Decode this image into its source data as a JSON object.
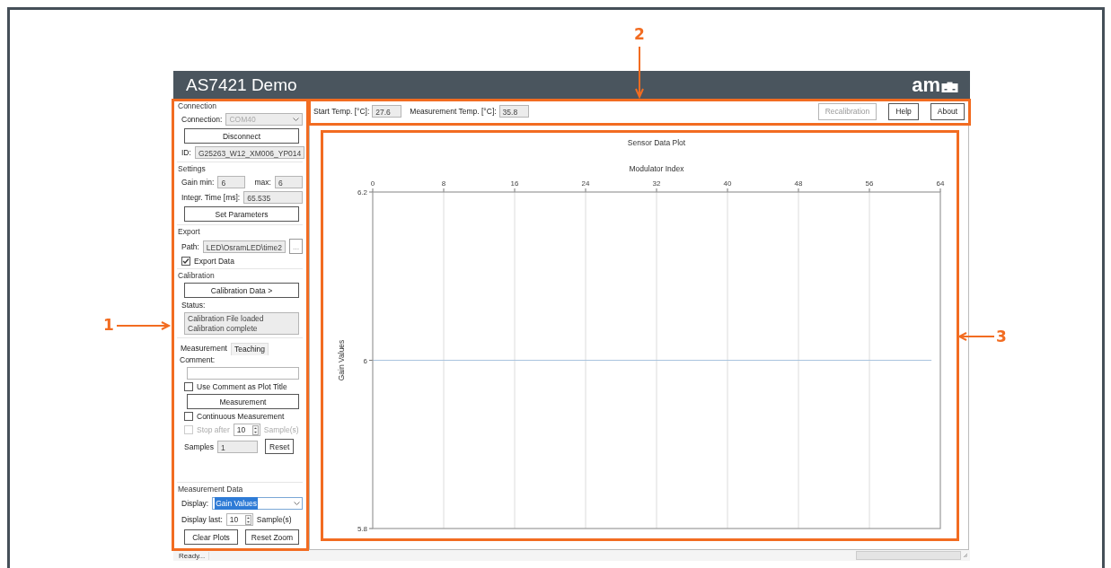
{
  "window": {
    "title": "AS7421 Demo",
    "logo": "am"
  },
  "connection": {
    "heading": "Connection",
    "port_label": "Connection:",
    "port": {
      "value": "COM40",
      "disabled": true
    },
    "disconnect_button": "Disconnect",
    "id_label": "ID:",
    "id_value": "G25263_W12_XM006_YP014"
  },
  "settings": {
    "heading": "Settings",
    "gain_min_label": "Gain min:",
    "gain_min": "6",
    "gain_max_label": "max:",
    "gain_max": "6",
    "integration_label": "Integr. Time [ms]:",
    "integration_time": "65.535",
    "set_button": "Set Parameters"
  },
  "export": {
    "heading": "Export",
    "path_label": "Path:",
    "path": {
      "value": "LED\\OsramLED\\time2",
      "disabled": true
    },
    "browse_button": "...",
    "export_data": {
      "label": "Export Data",
      "checked": true,
      "disabled": false
    }
  },
  "calibration": {
    "heading": "Calibration",
    "data_button": "Calibration Data >",
    "status_label": "Status:",
    "status_lines": [
      "Calibration File loaded",
      "Calibration complete"
    ]
  },
  "tabs": [
    {
      "label": "Measurement",
      "selected": true
    },
    {
      "label": "Teaching",
      "selected": false
    }
  ],
  "measurement": {
    "comment_label": "Comment:",
    "use_comment": {
      "label": "Use Comment as Plot Title",
      "checked": false,
      "disabled": false
    },
    "measure_button": "Measurement",
    "continuous": {
      "label": "Continuous Measurement",
      "checked": false,
      "disabled": false
    },
    "stop_after": {
      "label": "Stop after",
      "checked": false,
      "disabled": true
    },
    "stop_after_count": "10",
    "stop_after_unit": "Sample(s)",
    "samples_label": "Samples",
    "samples": "1",
    "reset_button": "Reset"
  },
  "measurement_data": {
    "heading": "Measurement Data",
    "display_label": "Display:",
    "display": {
      "value": "Gain Values",
      "focused": true
    },
    "display_last_label": "Display last:",
    "display_last": "10",
    "display_last_unit": "Sample(s)",
    "buttons": [
      "Clear Plots",
      "Reset Zoom"
    ]
  },
  "toolbar": {
    "start_temp_label": "Start Temp. [°C]:",
    "start_temp": "27.6",
    "measurement_temp_label": "Measurement Temp. [°C]:",
    "measurement_temp": "35.8",
    "buttons": [
      {
        "label": "Recalibration",
        "disabled": true
      },
      {
        "label": "Help",
        "disabled": false
      },
      {
        "label": "About",
        "disabled": false
      }
    ]
  },
  "plot": {
    "chart_data": {
      "type": "line",
      "title": "Sensor Data Plot",
      "xlabel": "Modulator Index",
      "ylabel": "Gain Values",
      "x": [
        0,
        63
      ],
      "series": [
        {
          "color": "#a9c4de",
          "values": [
            6,
            6
          ]
        }
      ],
      "grid": true,
      "xlim": [
        0,
        64
      ],
      "ylim": [
        5.8,
        6.2
      ],
      "xticks": [
        0,
        8,
        16,
        24,
        32,
        40,
        48,
        56,
        64
      ],
      "yticks": [
        {
          "value": 5.8,
          "label": "5.8"
        },
        {
          "value": 6,
          "label": "6"
        },
        {
          "value": 6.2,
          "label": "6.2"
        }
      ]
    }
  },
  "status_bar": {
    "text": "Ready..."
  },
  "annotations": [
    {
      "label": "1"
    },
    {
      "label": "2"
    },
    {
      "label": "3"
    }
  ]
}
